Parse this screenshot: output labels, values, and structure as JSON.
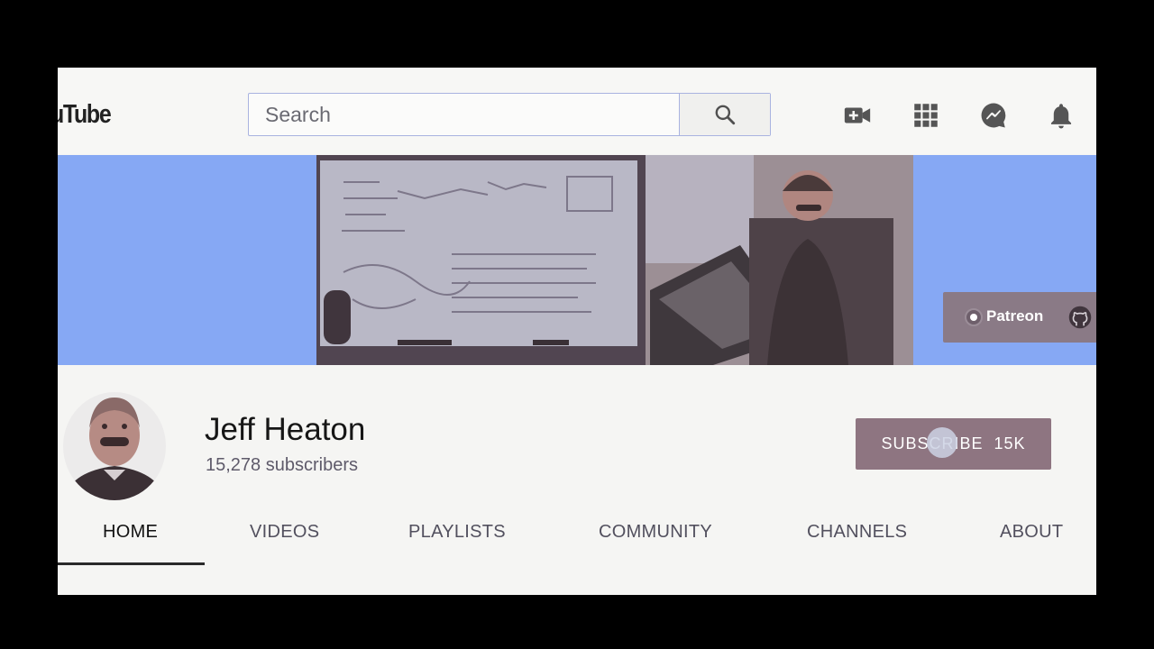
{
  "header": {
    "logo_text": "ouTube",
    "search_placeholder": "Search",
    "icons": [
      "search-icon",
      "video-camera-icon",
      "apps-grid-icon",
      "messages-icon",
      "bell-icon"
    ]
  },
  "banner": {
    "link": {
      "label": "Patreon",
      "icons": [
        "patreon-icon",
        "github-icon"
      ]
    }
  },
  "channel": {
    "name": "Jeff Heaton",
    "subscribers": "15,278 subscribers",
    "subscribe_label": "SUBSCRIBE",
    "subscribe_count": "15K"
  },
  "tabs": [
    "HOME",
    "VIDEOS",
    "PLAYLISTS",
    "COMMUNITY",
    "CHANNELS",
    "ABOUT"
  ],
  "colors": {
    "banner_bg": "#86a8f4",
    "subscribe_bg": "#8e7581",
    "page_bg": "#f5f5f3"
  }
}
